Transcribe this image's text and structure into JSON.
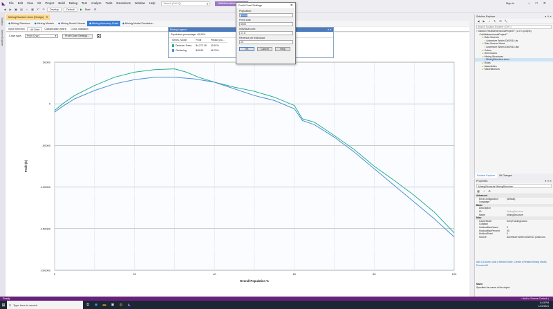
{
  "menubar": {
    "items": [
      "File",
      "Edit",
      "View",
      "Git",
      "Project",
      "Build",
      "Debug",
      "Test",
      "Analyze",
      "Tools",
      "Extensions",
      "Window",
      "Help"
    ],
    "search_placeholder": "Search (Ctrl+Q)",
    "project_name": "MultidimensionalProject7",
    "sign_in": "Sign in"
  },
  "toolbar": {
    "config": "Develop",
    "platform": "Default",
    "start": "Start"
  },
  "left_tabs": [
    "Toolbox",
    "Server Explorer"
  ],
  "document_tab": {
    "label": "MiningStructure.dmm [Design]"
  },
  "designer_tabs": [
    {
      "label": "Mining Structure",
      "icon": "structure-icon",
      "active": false
    },
    {
      "label": "Mining Models",
      "icon": "models-icon",
      "active": false
    },
    {
      "label": "Mining Model Viewer",
      "icon": "viewer-icon",
      "active": false
    },
    {
      "label": "Mining Accuracy Chart",
      "icon": "accuracy-chart-icon",
      "active": true
    },
    {
      "label": "Mining Model Prediction",
      "icon": "prediction-icon",
      "active": false
    }
  ],
  "sub_tabs": [
    "Input Selection",
    "Lift Chart",
    "Classification Matrix",
    "Cross Validation"
  ],
  "chart_type_bar": {
    "label": "Chart type:",
    "value": "Profit Chart",
    "settings_button": "Profit Chart Settings..."
  },
  "mining_legend": {
    "title": "Mining Legend",
    "population": "Population percentage: 49.99%",
    "columns": [
      "Series, Model",
      "Profit",
      "Predict pro..."
    ],
    "rows": [
      {
        "name": "Decision Trees",
        "profit": "$4,272.18",
        "predict": "43.61%",
        "color": "#26b08a"
      },
      {
        "name": "Clustering",
        "profit": "$49.86",
        "predict": "46.76%",
        "color": "#4b8fd8"
      }
    ]
  },
  "dialog": {
    "title": "Profit Chart Settings",
    "population_label": "Population:",
    "population_value": "20000",
    "fixed_cost_label": "Fixed cost:",
    "fixed_cost_value": "5000",
    "individual_cost_label": "Individual cost:",
    "individual_cost_value": "17.5",
    "revenue_label": "Revenue per individual:",
    "revenue_value": "20",
    "ok": "OK",
    "cancel": "Cancel",
    "help": "Help"
  },
  "solution_explorer": {
    "title": "Solution Explorer",
    "search_placeholder": "Search Solution Explorer (Ctrl+;)",
    "tree": [
      {
        "indent": 0,
        "label": "Solution 'MultidimensionalProject7' (1 of 1 project)",
        "icon": "solution-icon",
        "selected": false
      },
      {
        "indent": 1,
        "label": "MultidimensionalProject7",
        "icon": "project-icon",
        "selected": false
      },
      {
        "indent": 2,
        "label": "Data Sources",
        "icon": "folder-icon",
        "selected": false
      },
      {
        "indent": 3,
        "label": "Adventure Works DW2014.ds",
        "icon": "datasource-icon",
        "selected": false
      },
      {
        "indent": 2,
        "label": "Data Source Views",
        "icon": "folder-icon",
        "selected": false
      },
      {
        "indent": 3,
        "label": "Adventure Works DW2014.dsv",
        "icon": "dsv-icon",
        "selected": false
      },
      {
        "indent": 2,
        "label": "Cubes",
        "icon": "folder-icon",
        "selected": false
      },
      {
        "indent": 2,
        "label": "Dimensions",
        "icon": "folder-icon",
        "selected": false
      },
      {
        "indent": 2,
        "label": "Mining Structures",
        "icon": "folder-icon",
        "selected": false
      },
      {
        "indent": 3,
        "label": "MiningStructure.dmm",
        "icon": "mining-structure-icon",
        "selected": true
      },
      {
        "indent": 2,
        "label": "Roles",
        "icon": "folder-icon",
        "selected": false
      },
      {
        "indent": 2,
        "label": "Assemblies",
        "icon": "folder-icon",
        "selected": false
      },
      {
        "indent": 2,
        "label": "Miscellaneous",
        "icon": "folder-icon",
        "selected": false
      }
    ],
    "bottom_tabs": [
      "Solution Explorer",
      "Git Changes"
    ]
  },
  "properties": {
    "title": "Properties",
    "object": "MiningStructure  MiningStructure",
    "rows": [
      {
        "cat": true,
        "k": "Advanced",
        "v": ""
      },
      {
        "cat": false,
        "k": "ErrorConfiguration",
        "v": "(default)",
        "gray": false
      },
      {
        "cat": false,
        "k": "Language",
        "v": "",
        "gray": false
      },
      {
        "cat": true,
        "k": "Basic",
        "v": ""
      },
      {
        "cat": false,
        "k": "Description",
        "v": "",
        "gray": false
      },
      {
        "cat": false,
        "k": "ID",
        "v": "MiningStructure",
        "gray": true
      },
      {
        "cat": false,
        "k": "Name",
        "v": "MiningStructure",
        "gray": false
      },
      {
        "cat": true,
        "k": "Misc",
        "v": ""
      },
      {
        "cat": false,
        "k": "CacheMode",
        "v": "KeepTrainingCases",
        "gray": false
      },
      {
        "cat": false,
        "k": "Collation",
        "v": "",
        "gray": false
      },
      {
        "cat": false,
        "k": "HoldoutMaxCases",
        "v": "0",
        "gray": false
      },
      {
        "cat": false,
        "k": "HoldoutMaxPercent",
        "v": "30",
        "gray": false
      },
      {
        "cat": false,
        "k": "HoldoutSeed",
        "v": "0",
        "gray": false
      },
      {
        "cat": false,
        "k": "Source",
        "v": "Adventure Works DW2014 (Data sou",
        "gray": false
      }
    ],
    "links": "Add a Column, Add a Nested Table, Create a Related Mining Model, Process All",
    "desc_title": "Name",
    "desc_text": "Specifies the name of the object."
  },
  "status": {
    "left": "Ready",
    "right": "↑ Add to Source Control ▴"
  },
  "taskbar": {
    "search": "Type here to search",
    "time": "8:43 PM",
    "date": "1/21/2021"
  },
  "chart_data": {
    "type": "line",
    "xlabel": "Overall Population %",
    "ylabel": "Profit ($)",
    "xlim": [
      0,
      100
    ],
    "ylim": [
      -200000,
      50000
    ],
    "xticks": [
      0,
      20,
      40,
      60,
      80,
      100
    ],
    "yticks": [
      50000,
      0,
      -50000,
      -100000,
      -150000,
      -200000
    ],
    "ytick_labels": [
      "50000",
      "0",
      "-50000",
      "-100000",
      "-150000",
      "-200000"
    ],
    "grid": true,
    "series": [
      {
        "name": "Decision Trees",
        "color": "#26b08a",
        "x": [
          0,
          2,
          5,
          10,
          15,
          20,
          25,
          30,
          33,
          36,
          40,
          45,
          50,
          55,
          60,
          62,
          65,
          70,
          75,
          80,
          85,
          90,
          95,
          100
        ],
        "y": [
          -8000,
          0,
          10000,
          22000,
          32000,
          38000,
          41000,
          42000,
          38000,
          32000,
          26000,
          20000,
          15000,
          8000,
          -2000,
          -18000,
          -22000,
          -38000,
          -55000,
          -75000,
          -92000,
          -110000,
          -130000,
          -155000
        ]
      },
      {
        "name": "Clustering",
        "color": "#4b8fd8",
        "x": [
          0,
          2,
          5,
          10,
          15,
          20,
          25,
          30,
          35,
          40,
          45,
          50,
          55,
          60,
          62,
          65,
          70,
          75,
          80,
          85,
          90,
          95,
          100
        ],
        "y": [
          -10000,
          -3000,
          6000,
          16000,
          24000,
          29000,
          32000,
          32000,
          30000,
          26000,
          18000,
          10000,
          4000,
          -6000,
          -20000,
          -25000,
          -40000,
          -58000,
          -78000,
          -98000,
          -118000,
          -138000,
          -160000
        ]
      }
    ]
  }
}
